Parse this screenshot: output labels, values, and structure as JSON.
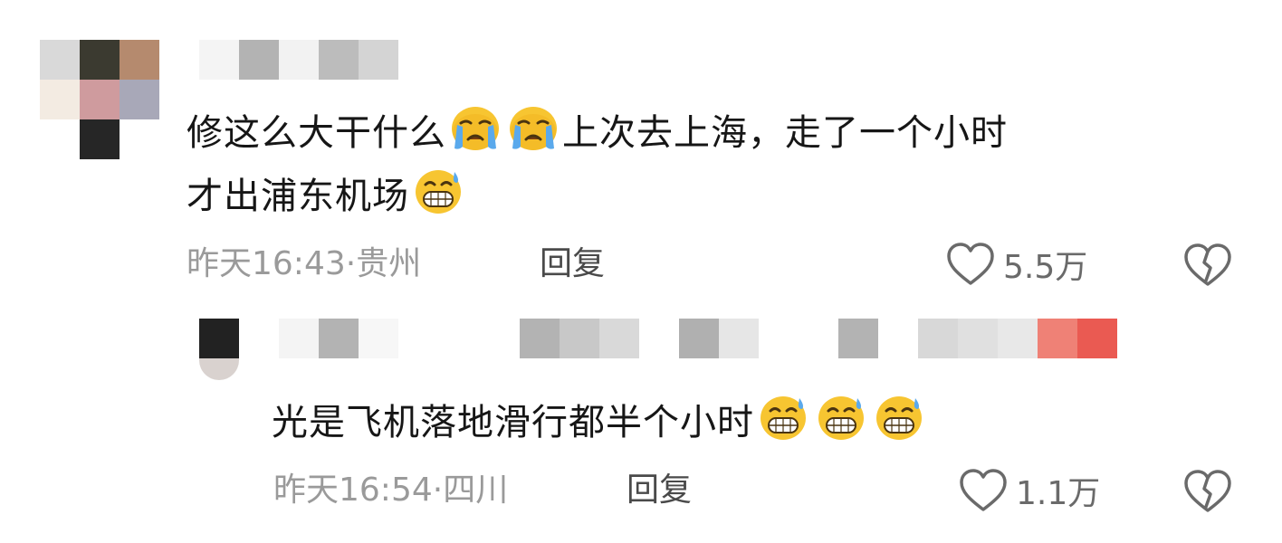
{
  "comments": [
    {
      "text": "修这么大干什么",
      "text_after": "上次去上海，走了一个小时",
      "text_line2": "才出浦东机场",
      "time": "昨天16:43·贵州",
      "reply_label": "回复",
      "likes": "5.5万",
      "emoji": [
        "loudly-crying-face-emoji",
        "loudly-crying-face-emoji",
        "grinning-sweat-face-emoji"
      ]
    },
    {
      "text": "光是飞机落地滑行都半个小时",
      "time": "昨天16:54·四川",
      "reply_label": "回复",
      "likes": "1.1万",
      "emoji": [
        "grinning-sweat-face-emoji",
        "grinning-sweat-face-emoji",
        "grinning-sweat-face-emoji"
      ]
    }
  ],
  "icons": {
    "like": "heart-outline-icon",
    "dislike": "broken-heart-icon"
  },
  "colors": {
    "text": "#161616",
    "meta": "#9a9a9a",
    "reply": "#4a4a4a",
    "avatar_pixels_1": [
      "#d9d9d9",
      "#3b3a30",
      "#b58a6e",
      "#f3ebe2",
      "#cf9b9e",
      "#a8a8b8",
      "#262626"
    ],
    "avatar_pixels_2": [
      "#222222",
      "#d9d2cf"
    ],
    "redaction_gray": [
      "#efefef",
      "#b3b3b3",
      "#cfcfcf",
      "#e0e0e0"
    ],
    "redaction_red": [
      "#ef8176",
      "#ea5a52"
    ]
  }
}
